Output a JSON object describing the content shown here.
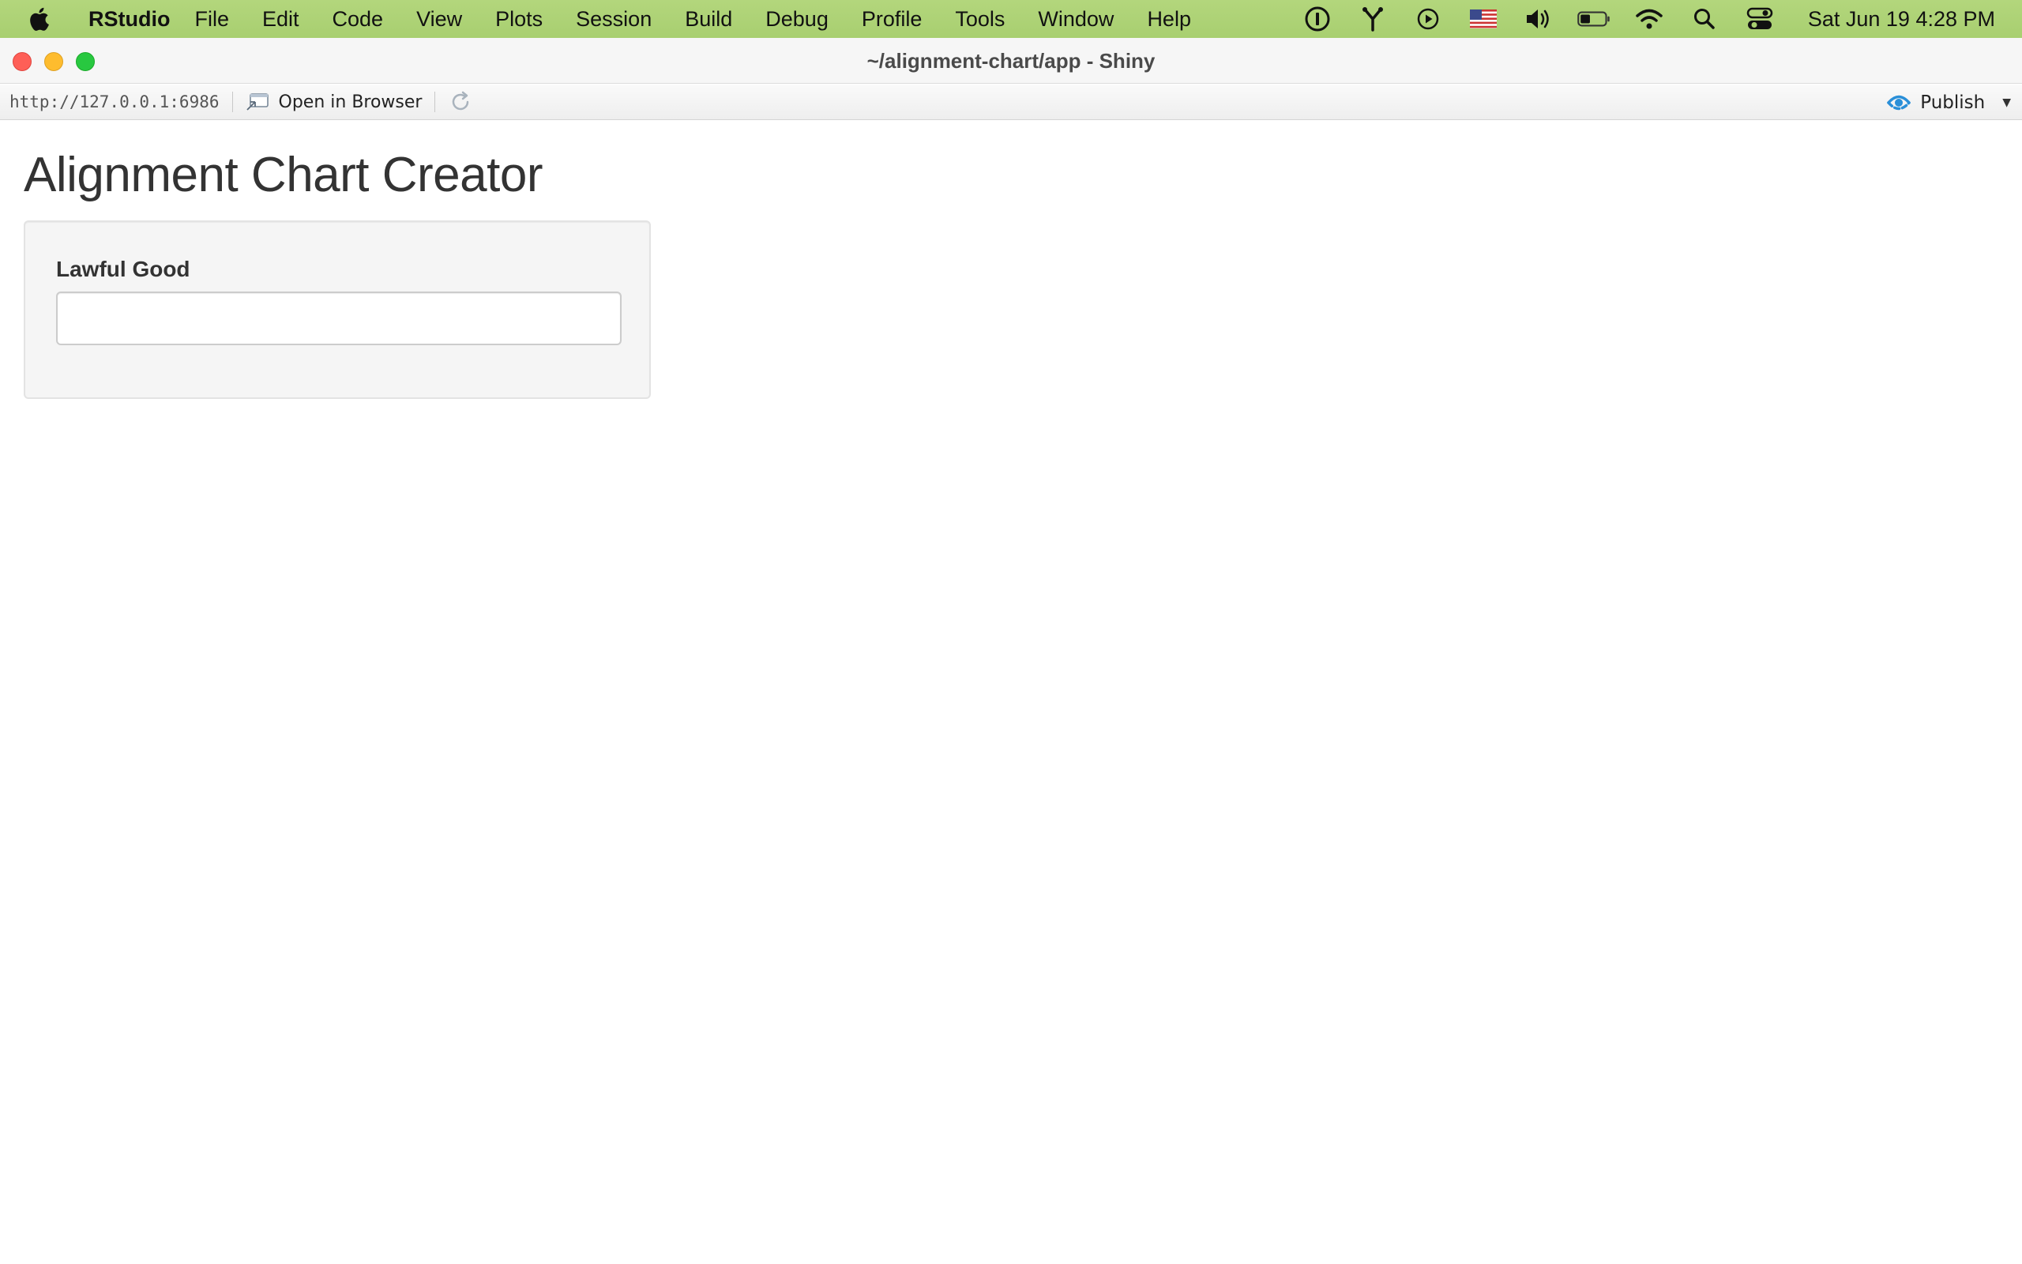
{
  "menubar": {
    "app_name": "RStudio",
    "items": [
      "File",
      "Edit",
      "Code",
      "View",
      "Plots",
      "Session",
      "Build",
      "Debug",
      "Profile",
      "Tools",
      "Window",
      "Help"
    ],
    "status_icons": [
      "1password-icon",
      "fork-icon",
      "play-circle-icon",
      "us-flag-icon",
      "volume-icon",
      "battery-icon",
      "wifi-icon",
      "spotlight-search-icon",
      "control-center-icon"
    ],
    "clock": "Sat Jun 19  4:28 PM"
  },
  "window": {
    "title": "~/alignment-chart/app - Shiny"
  },
  "toolbar": {
    "url": "http://127.0.0.1:6986",
    "open_browser_label": "Open in Browser",
    "publish_label": "Publish"
  },
  "app": {
    "title": "Alignment Chart Creator",
    "field_label": "Lawful Good",
    "field_value": ""
  },
  "colors": {
    "menubar_bg": "#a8cf70",
    "publish_accent": "#2a8fd8",
    "well_bg": "#f5f5f5"
  }
}
